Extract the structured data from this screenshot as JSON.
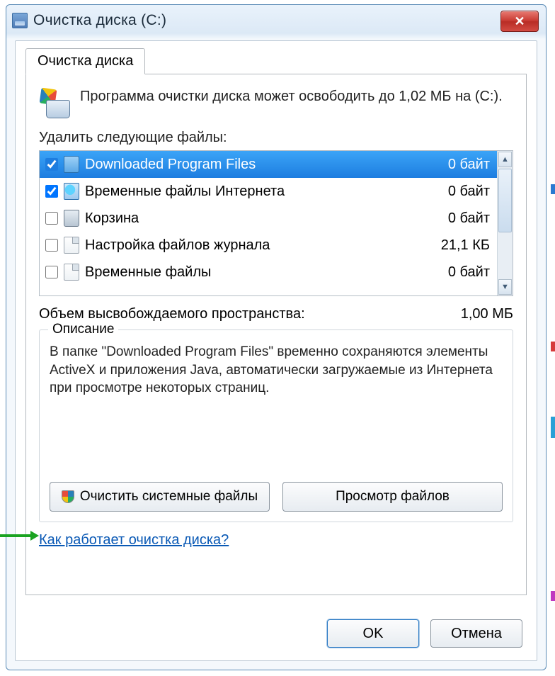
{
  "window": {
    "title": "Очистка диска  (C:)"
  },
  "tab": {
    "label": "Очистка диска"
  },
  "intro": {
    "text": "Программа очистки диска может освободить до 1,02 МБ на  (C:)."
  },
  "list_label": "Удалить следующие файлы:",
  "files": [
    {
      "checked": true,
      "icon": "folder",
      "name": "Downloaded Program Files",
      "size": "0 байт",
      "selected": true
    },
    {
      "checked": true,
      "icon": "ie",
      "name": "Временные файлы Интернета",
      "size": "0 байт",
      "selected": false
    },
    {
      "checked": false,
      "icon": "bin",
      "name": "Корзина",
      "size": "0 байт",
      "selected": false
    },
    {
      "checked": false,
      "icon": "doc",
      "name": "Настройка файлов журнала",
      "size": "21,1 КБ",
      "selected": false
    },
    {
      "checked": false,
      "icon": "doc",
      "name": "Временные файлы",
      "size": "0 байт",
      "selected": false
    }
  ],
  "total": {
    "label": "Объем высвобождаемого пространства:",
    "value": "1,00 МБ"
  },
  "description": {
    "title": "Описание",
    "text": "В папке \"Downloaded Program Files\" временно сохраняются элементы ActiveX и приложения Java, автоматически загружаемые из Интернета при просмотре некоторых страниц."
  },
  "buttons": {
    "clean_system": "Очистить системные файлы",
    "view_files": "Просмотр файлов",
    "ok": "OK",
    "cancel": "Отмена"
  },
  "help_link": "Как работает очистка диска?"
}
